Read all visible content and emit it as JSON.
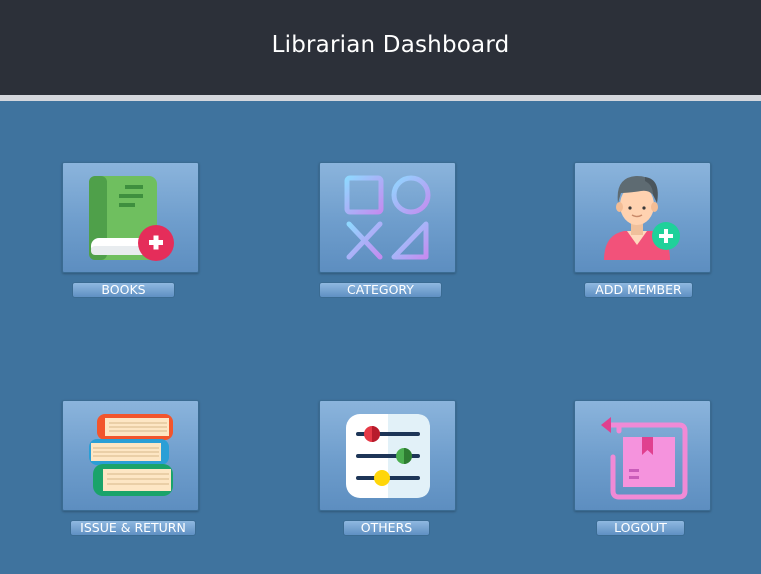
{
  "header": {
    "title": "Librarian Dashboard"
  },
  "tiles": [
    {
      "label": "BOOKS",
      "icon": "book-add-icon"
    },
    {
      "label": "CATEGORY",
      "icon": "category-shapes-icon"
    },
    {
      "label": "ADD MEMBER",
      "icon": "add-member-icon"
    },
    {
      "label": "ISSUE & RETURN",
      "icon": "book-stack-icon"
    },
    {
      "label": "OTHERS",
      "icon": "settings-sliders-icon"
    },
    {
      "label": "LOGOUT",
      "icon": "logout-box-icon"
    }
  ],
  "colors": {
    "background": "#3f739e",
    "header": "#2c3039",
    "header_rule": "#d4d7dd"
  }
}
